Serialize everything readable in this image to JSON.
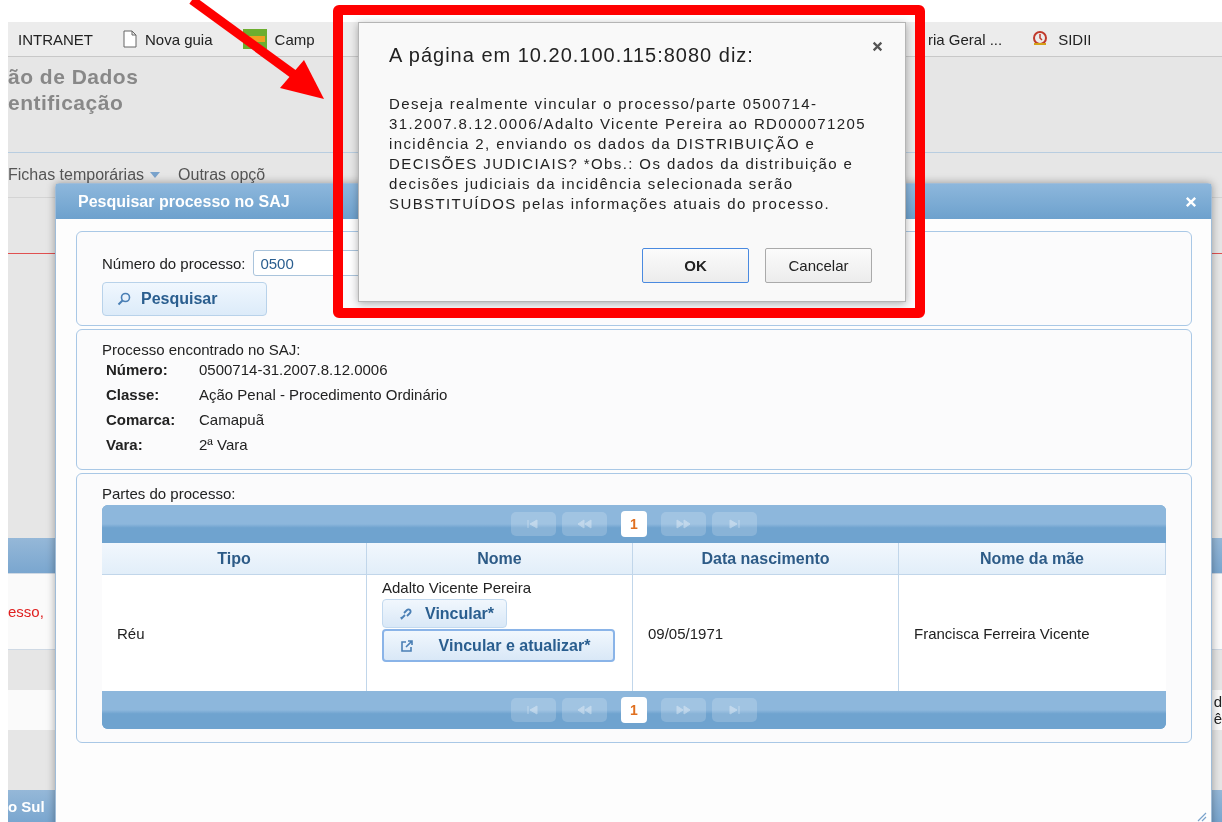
{
  "bookmarks_bar": {
    "items": [
      {
        "label": "INTRANET",
        "kind": "plain"
      },
      {
        "label": "Nova guia",
        "kind": "page"
      },
      {
        "label": "Camp",
        "kind": "news"
      },
      {
        "label": "ria Geral ...",
        "kind": "plain"
      },
      {
        "label": "SIDII",
        "kind": "seal"
      }
    ]
  },
  "page_header": {
    "lines": [
      "ão de Dados",
      "entificação"
    ]
  },
  "menu": {
    "items": [
      {
        "label": "Fichas temporárias",
        "dropdown": true
      },
      {
        "label": "Outras opçõ",
        "dropdown": false
      }
    ]
  },
  "background_fragments": {
    "red_text": "esso,",
    "right_lines": [
      "d",
      "ê"
    ],
    "footer_text": "o Sul"
  },
  "modal": {
    "title": "Pesquisar processo no SAJ",
    "search": {
      "label": "Número do processo:",
      "value": "0500",
      "button": "Pesquisar"
    },
    "found": {
      "title": "Processo encontrado no SAJ:",
      "fields": [
        {
          "label": "Número:",
          "value": "0500714-31.2007.8.12.0006"
        },
        {
          "label": "Classe:",
          "value": "Ação Penal - Procedimento Ordinário"
        },
        {
          "label": "Comarca:",
          "value": "Camapuã"
        },
        {
          "label": "Vara:",
          "value": "2ª Vara"
        }
      ]
    },
    "parties": {
      "title": "Partes do processo:",
      "pagers": [
        {
          "nav": [
            {
              "kind": "first",
              "disabled": true
            },
            {
              "kind": "prev",
              "disabled": true
            },
            {
              "kind": "next",
              "disabled": true
            },
            {
              "kind": "last",
              "disabled": true
            }
          ],
          "pages": [
            {
              "label": "1",
              "selected": true
            }
          ]
        },
        {
          "nav": [
            {
              "kind": "first",
              "disabled": true
            },
            {
              "kind": "prev",
              "disabled": true
            },
            {
              "kind": "next",
              "disabled": true
            },
            {
              "kind": "last",
              "disabled": true
            }
          ],
          "pages": [
            {
              "label": "1",
              "selected": true
            }
          ]
        }
      ],
      "columns": [
        "Tipo",
        "Nome",
        "Data nascimento",
        "Nome da mãe"
      ],
      "rows": [
        {
          "tipo": "Réu",
          "nome": "Adalto Vicente Pereira",
          "actions": [
            {
              "label": "Vincular*",
              "kind": "link",
              "focused": false
            },
            {
              "label": "Vincular e atualizar*",
              "kind": "external",
              "focused": true
            }
          ],
          "data_nascimento": "09/05/1971",
          "nome_da_mae": "Francisca Ferreira Vicente"
        }
      ]
    }
  },
  "confirm_dialog": {
    "title": "A página em 10.20.100.115:8080 diz:",
    "message": "Deseja realmente vincular o processo/parte 0500714-31.2007.8.12.0006/Adalto Vicente Pereira ao RD000071205 incidência 2, enviando os dados da DISTRIBUIÇÃO e DECISÕES JUDICIAIS? *Obs.: Os dados da distribuição e decisões judiciais da incidência selecionada serão SUBSTITUÍDOS pelas informações atuais do processo.",
    "buttons": [
      {
        "label": "OK",
        "focused": true
      },
      {
        "label": "Cancelar",
        "focused": false
      }
    ]
  }
}
